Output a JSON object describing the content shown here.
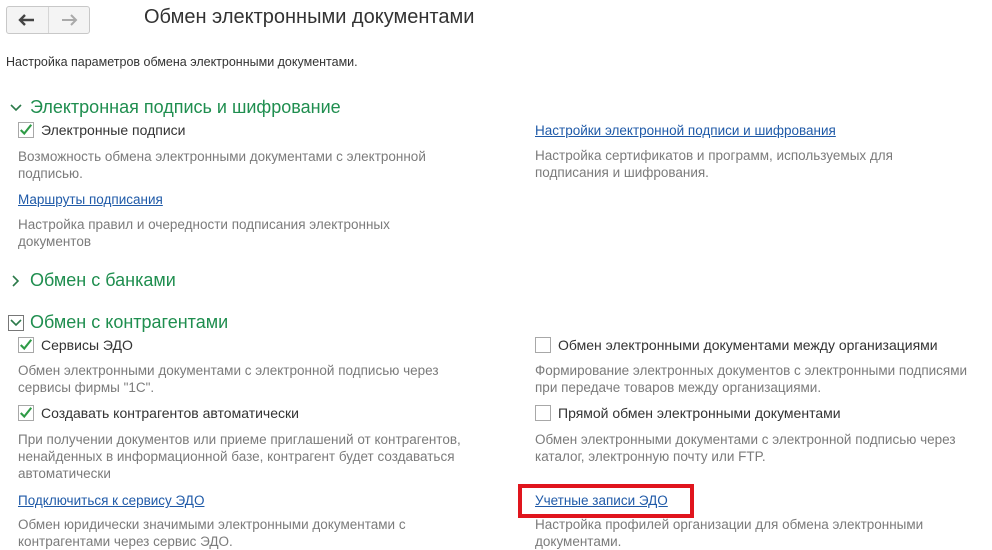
{
  "header": {
    "title": "Обмен электронными документами",
    "subtitle": "Настройка параметров обмена электронными документами."
  },
  "sections": {
    "signature": {
      "title": "Электронная подпись и шифрование",
      "signatures_label": "Электронные подписи",
      "signatures_checked": true,
      "signatures_desc": "Возможность обмена электронными документами с электронной подписью.",
      "routes_link": "Маршруты подписания",
      "routes_desc": "Настройка правил и очередности подписания электронных документов",
      "settings_link": "Настройки электронной подписи и шифрования",
      "settings_desc": "Настройка сертификатов и программ, используемых для подписания и шифрования."
    },
    "banks": {
      "title": "Обмен с банками"
    },
    "counterparties": {
      "title": "Обмен с контрагентами",
      "edo_services_label": "Сервисы ЭДО",
      "edo_services_checked": true,
      "edo_services_desc": "Обмен электронными документами с электронной подписью через сервисы фирмы \"1С\".",
      "auto_create_label": "Создавать контрагентов автоматически",
      "auto_create_checked": true,
      "auto_create_desc": "При получении документов или приеме приглашений от контрагентов, ненайденных в информационной базе, контрагент будет создаваться автоматически",
      "connect_link": "Подключиться к сервису ЭДО",
      "connect_desc": "Обмен юридически значимыми электронными документами с контрагентами через сервис ЭДО.",
      "between_orgs_label": "Обмен электронными документами между организациями",
      "between_orgs_checked": false,
      "between_orgs_desc": "Формирование электронных документов с электронными подписями при передаче товаров между организациями.",
      "direct_label": "Прямой обмен электронными документами",
      "direct_checked": false,
      "direct_desc": "Обмен электронными документами с электронной подписью через каталог, электронную почту или FTP.",
      "accounts_link": "Учетные записи ЭДО",
      "accounts_desc": "Настройка профилей организации для обмена электронными документами."
    }
  },
  "colors": {
    "section_title": "#1f8e4f",
    "link": "#1f5aa8",
    "check": "#2e9b46",
    "highlight": "#e0151d"
  }
}
